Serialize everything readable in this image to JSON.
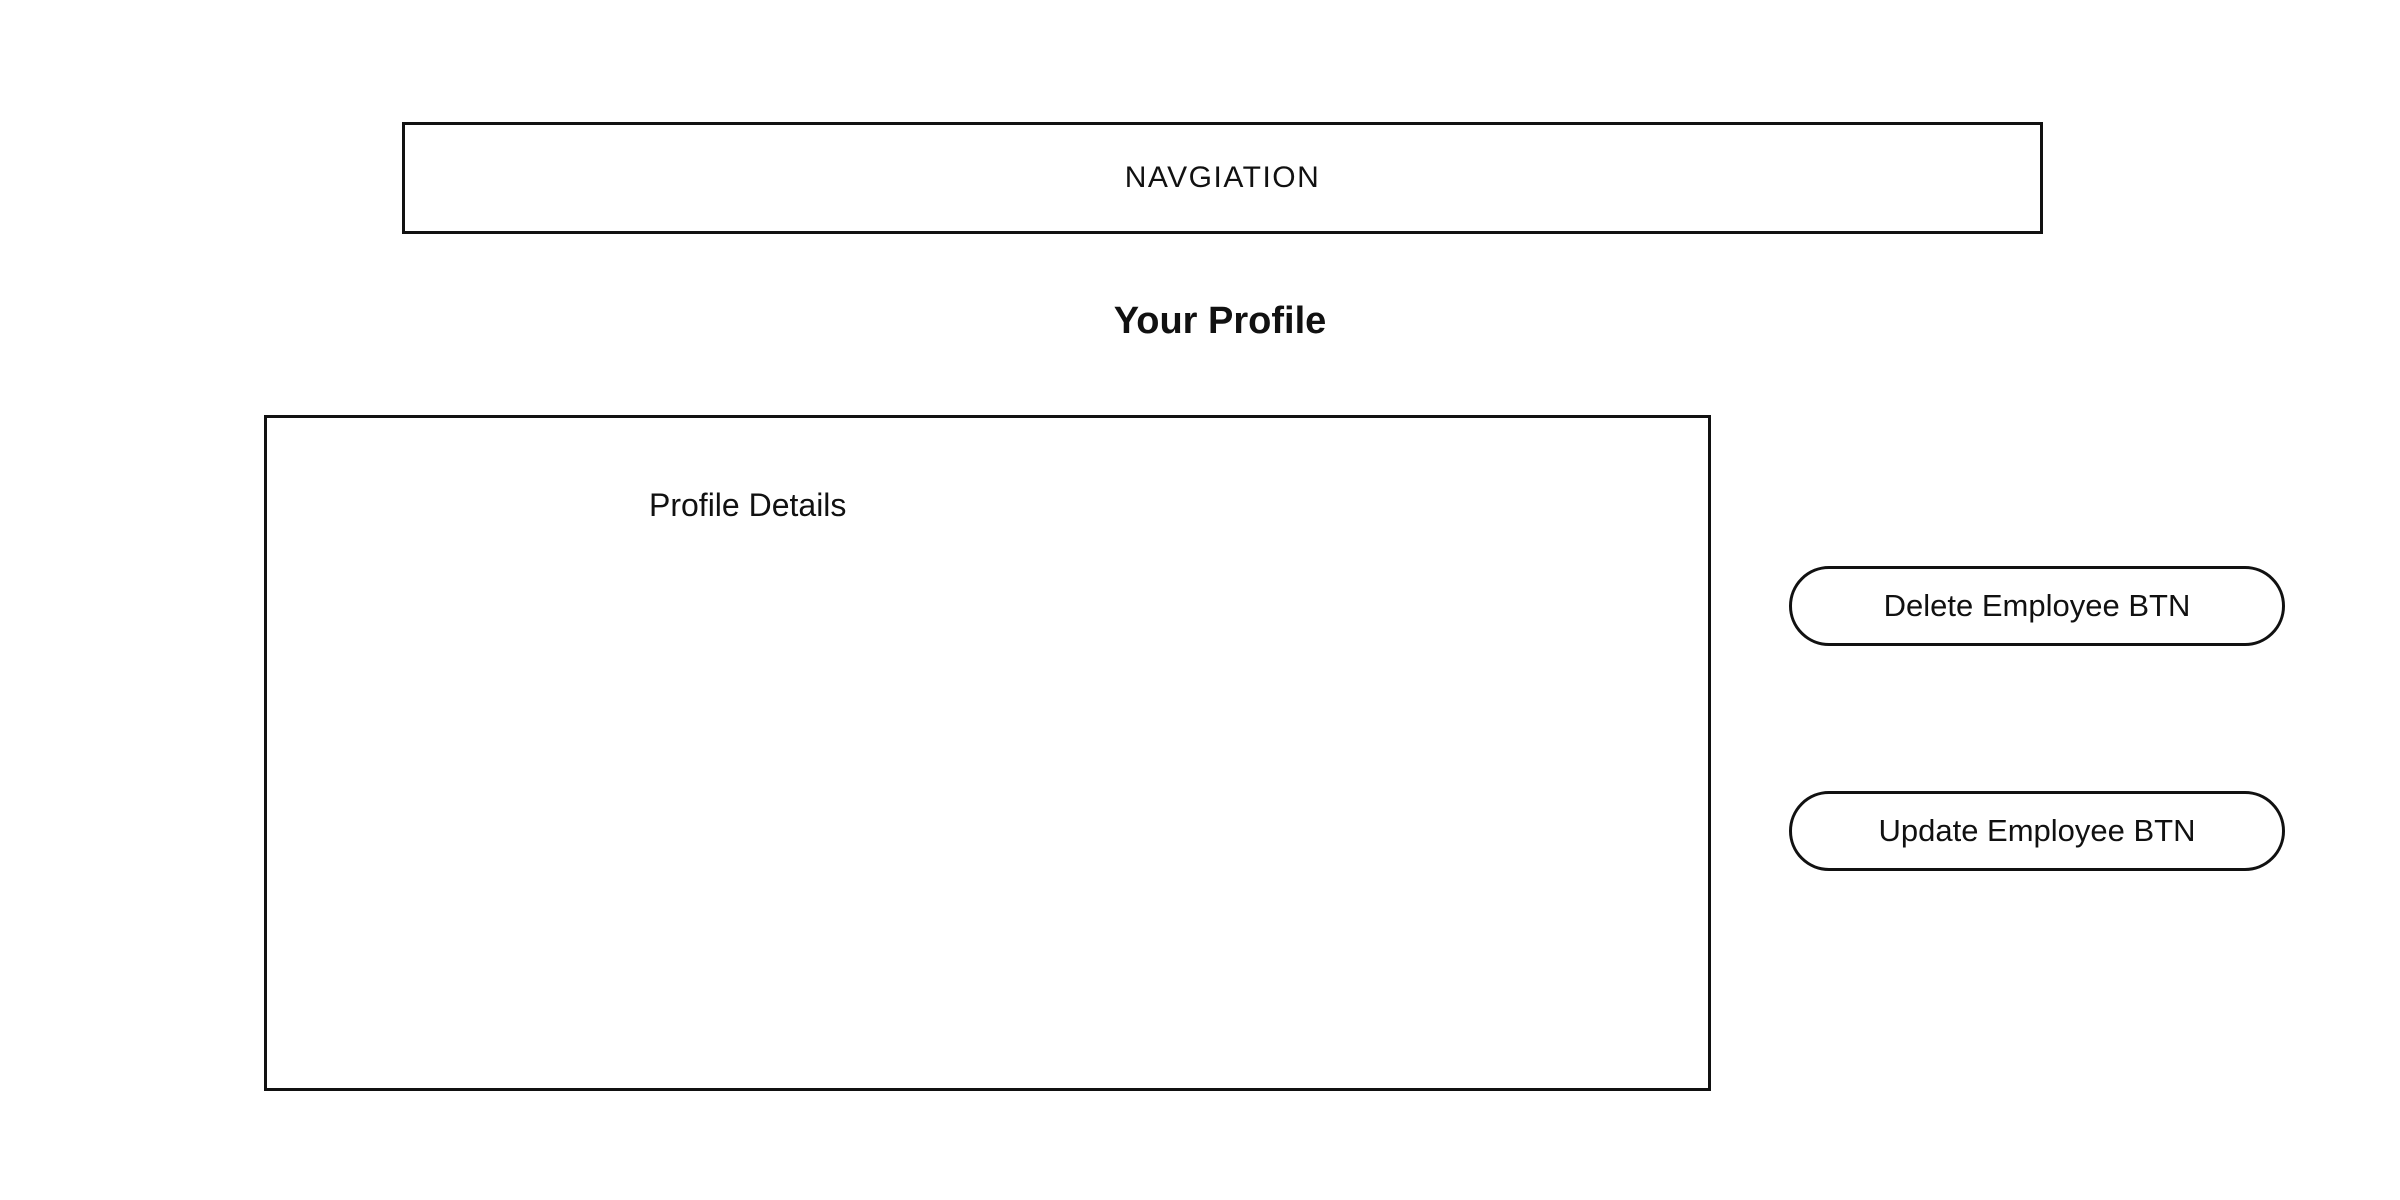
{
  "navigation": {
    "label": "NAVGIATION"
  },
  "page": {
    "title": "Your Profile"
  },
  "profile": {
    "details_label": "Profile Details"
  },
  "actions": {
    "delete_label": "Delete Employee BTN",
    "update_label": "Update Employee BTN"
  },
  "colors": {
    "stroke": "#111111",
    "background": "#ffffff"
  }
}
